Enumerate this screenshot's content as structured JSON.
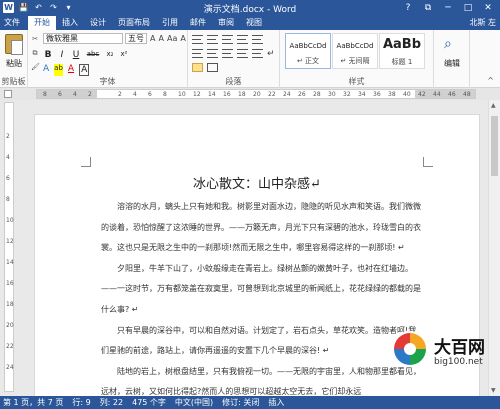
{
  "window": {
    "title": "演示文档.docx - Word",
    "help": "?",
    "restore": "⧉",
    "minimize": "─",
    "maximize": "□",
    "close": "✕"
  },
  "qat": {
    "word_logo": "W",
    "save": "💾",
    "undo": "↶",
    "redo": "↷",
    "customize": "▾"
  },
  "tabs": {
    "file": "文件",
    "items": [
      {
        "label": "开始",
        "active": true
      },
      {
        "label": "插入",
        "active": false
      },
      {
        "label": "设计",
        "active": false
      },
      {
        "label": "页面布局",
        "active": false
      },
      {
        "label": "引用",
        "active": false
      },
      {
        "label": "邮件",
        "active": false
      },
      {
        "label": "审阅",
        "active": false
      },
      {
        "label": "视图",
        "active": false
      }
    ],
    "user": "北斯 左"
  },
  "ribbon": {
    "clipboard": {
      "paste": "粘贴",
      "label": "剪贴板"
    },
    "font": {
      "name": "微软雅黑",
      "size": "五号",
      "grow": "A",
      "shrink": "A",
      "case": "Aa",
      "clear": "A",
      "bold": "B",
      "italic": "I",
      "underline": "U",
      "strike": "abc",
      "subscript": "x₂",
      "superscript": "x²",
      "effects": "A",
      "highlight": "ab",
      "color": "A",
      "char_border": "A",
      "label": "字体"
    },
    "paragraph": {
      "label": "段落",
      "pilcrow": "↵"
    },
    "styles": {
      "label": "样式",
      "items": [
        {
          "sample": "AaBbCcDd",
          "name": "↵ 正文"
        },
        {
          "sample": "AaBbCcDd",
          "name": "↵ 无间隔"
        },
        {
          "sample": "AaBb",
          "name": "标题 1"
        }
      ]
    },
    "editing": {
      "label": "编辑"
    },
    "collapse": "^"
  },
  "ruler": {
    "h_ticks": [
      "8",
      "6",
      "4",
      "2",
      "",
      "2",
      "4",
      "6",
      "8",
      "10",
      "12",
      "14",
      "16",
      "18",
      "20",
      "22",
      "24",
      "26",
      "28",
      "30",
      "32",
      "34",
      "36",
      "38",
      "40",
      "42",
      "44",
      "46",
      "48"
    ],
    "v_ticks": [
      "2",
      "4",
      "6",
      "8",
      "10",
      "12",
      "14",
      "16",
      "18",
      "20",
      "22",
      "24"
    ]
  },
  "document": {
    "heading": "冰心散文：山中杂感↵",
    "paragraphs": [
      "溶溶的水月，螭头上只有她和我。树影里对面水边，隐隐的听见水声和笑语。我们微微的谈着，恐怕惊醒了这浓睡的世界。——万籁无声，月光下只有深碧的池水，玲珑雪白的衣裳。这也只是无限之生中的一刹那顷!然而无限之生中，哪里容易得这样的一刹那顷! ↵",
      "夕阳里，牛羊下山了，小蚊般缘走在青岩上。绿树丛颤的嫩黄叶子，也衬在红墙边。——一这时节，万有都笼盖在寂寞里，可曾想到北京城里的新闻纸上，花花绿绿的都载的是什么事? ↵",
      "只有早晨的深谷中，可以和自然对语。计划定了，岩石点头，草花欢笑。造物者呵!我们星驰的前途，路站上，请你再遥遥的安置下几个早晨的深谷! ↵",
      "陆地的岩上，树根盘结里，只有我俯视一切。——无限的宇宙里，人和物那里都看见，远材，云树，又如何比得起?然而人的思想可以超越太空无去，它们却永远"
    ]
  },
  "status": {
    "page": "第 1 页，共 7 页",
    "lines": "行: 9",
    "col": "列: 22",
    "words": "475 个字",
    "lang": "中文(中国)",
    "track": "修订: 关闭",
    "insert": "插入"
  },
  "watermark": {
    "name": "大百网",
    "url": "big100.net"
  }
}
